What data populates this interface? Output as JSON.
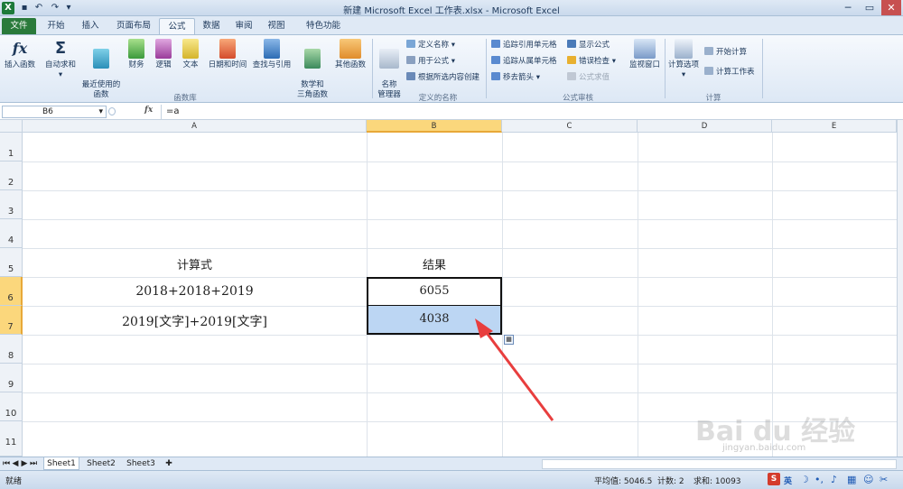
{
  "window": {
    "title": "新建 Microsoft Excel 工作表.xlsx  -  Microsoft Excel",
    "app_icon": "X",
    "minimize": "─",
    "restore": "▭",
    "close": "✕"
  },
  "tabs": [
    "文件",
    "开始",
    "插入",
    "页面布局",
    "公式",
    "数据",
    "审阅",
    "视图",
    "特色功能"
  ],
  "ribbon": {
    "group1": {
      "label": "函数库",
      "insert_fn": "插入函数",
      "insert_fn_icon": "fx",
      "autosum": "自动求和",
      "autosum_icon": "Σ",
      "recent": "最近使用的\n函数",
      "finance": "财务",
      "logic": "逻辑",
      "text": "文本",
      "datetime": "日期和时间",
      "lookup": "查找与引用",
      "math": "数学和\n三角函数",
      "other": "其他函数"
    },
    "group2": {
      "label": "定义的名称",
      "name_manager": "名称\n管理器",
      "define_name": "定义名称",
      "use_in_formula": "用于公式",
      "create_from_sel": "根据所选内容创建"
    },
    "group3": {
      "label": "公式审核",
      "trace_precedents": "追踪引用单元格",
      "trace_dependents": "追踪从属单元格",
      "remove_arrows": "移去箭头",
      "show_formulas": "显示公式",
      "error_check": "错误检查",
      "evaluate": "公式求值",
      "watch_window": "监视窗口"
    },
    "group4": {
      "label": "计算",
      "calc_options": "计算选项",
      "calc_now": "开始计算",
      "calc_sheet": "计算工作表"
    }
  },
  "formula_bar": {
    "name_box": "B6",
    "fx": "fx",
    "formula": "=a"
  },
  "columns": [
    "A",
    "B",
    "C",
    "D",
    "E"
  ],
  "rows": [
    "1",
    "2",
    "3",
    "4",
    "5",
    "6",
    "7",
    "8",
    "9",
    "10",
    "11"
  ],
  "cells": {
    "A5": "计算式",
    "B5": "结果",
    "A6": "2018+2018+2019",
    "B6": "6055",
    "A7": "2019[文字]+2019[文字]",
    "B7": "4038"
  },
  "sheets": [
    "Sheet1",
    "Sheet2",
    "Sheet3"
  ],
  "status": {
    "mode": "就绪",
    "average": "平均值: 5046.5",
    "count": "计数: 2",
    "sum": "求和: 10093"
  },
  "ime": {
    "logo": "S",
    "lang": "英"
  },
  "watermark": {
    "brand": "Bai du 经验",
    "url": "jingyan.baidu.com"
  },
  "colors": {
    "accent": "#2a7a3b",
    "selection_fill": "#bcd6f3",
    "arrow": "#e83e3e",
    "header_sel": "#fbd77c"
  }
}
